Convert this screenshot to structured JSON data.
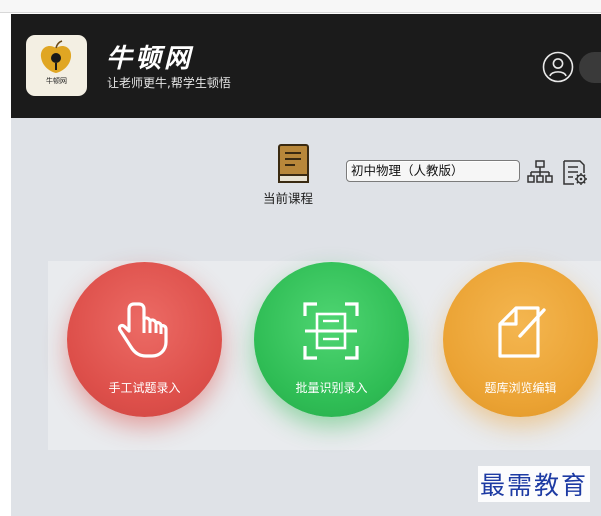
{
  "app": {
    "logo_text": "牛顿网",
    "title": "牛顿网",
    "slogan": "让老师更牛,帮学生顿悟"
  },
  "toolbar": {
    "current_course_label": "当前课程",
    "course_value": "初中物理（人教版）",
    "icons": [
      "book-icon",
      "org-chart-icon",
      "document-settings-icon",
      "user-icon"
    ]
  },
  "actions": [
    {
      "label": "手工试题录入",
      "icon": "hand-pointer-icon",
      "color": "#dd4f4a"
    },
    {
      "label": "批量识别录入",
      "icon": "scan-icon",
      "color": "#2fbd55"
    },
    {
      "label": "题库浏览编辑",
      "icon": "edit-document-icon",
      "color": "#eba334"
    }
  ],
  "watermark": "最需教育"
}
